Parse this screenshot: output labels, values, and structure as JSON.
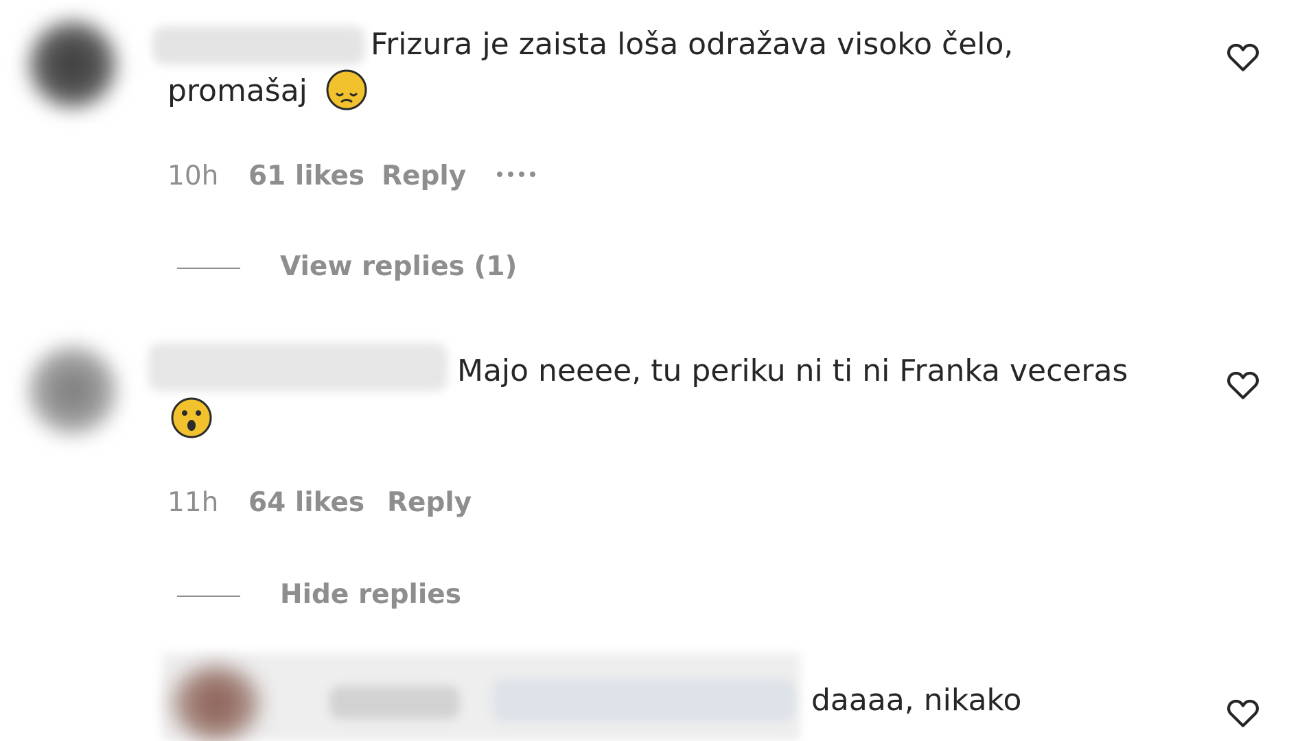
{
  "comments": [
    {
      "text_line1": "Frizura je zaista loša odražava visoko čelo,",
      "text_line2": "promašaj",
      "emoji": "sad-face-emoji",
      "time": "10h",
      "likes": "61 likes",
      "reply": "Reply",
      "thread_link": "View replies (1)"
    },
    {
      "text_line1": "Majo neeee, tu periku ni ti ni Franka veceras",
      "emoji": "astonished-face-emoji",
      "time": "11h",
      "likes": "64 likes",
      "reply": "Reply",
      "thread_link": "Hide replies"
    }
  ],
  "replies": [
    {
      "text": "daaaa, nikako"
    }
  ],
  "colors": {
    "text": "#262626",
    "meta": "#8e8e8e",
    "emoji": "#f2c12e"
  },
  "icons": {
    "like": "heart-outline-icon",
    "more": "more-options-icon"
  }
}
